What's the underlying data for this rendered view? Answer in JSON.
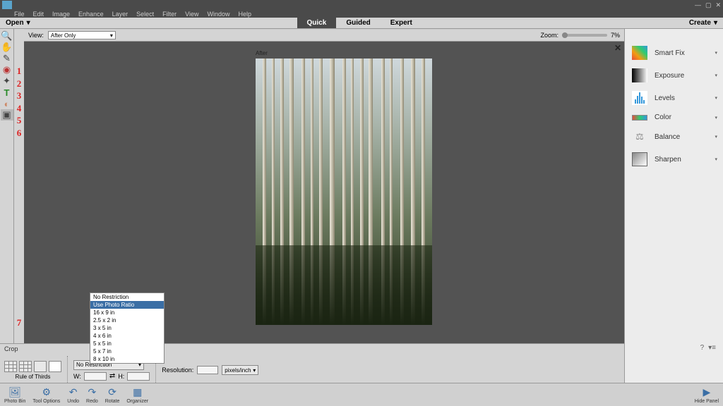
{
  "title_bar": {
    "min": "—",
    "max": "▢",
    "close": "✕"
  },
  "menu": {
    "file": "File",
    "edit": "Edit",
    "image": "Image",
    "enhance": "Enhance",
    "layer": "Layer",
    "select": "Select",
    "filter": "Filter",
    "view": "View",
    "window": "Window",
    "help": "Help"
  },
  "open_bar": {
    "open": "Open",
    "create": "Create"
  },
  "modes": {
    "quick": "Quick",
    "guided": "Guided",
    "expert": "Expert"
  },
  "view_bar": {
    "label": "View:",
    "selected": "After Only",
    "zoom_label": "Zoom:",
    "zoom_value": "7%"
  },
  "workspace": {
    "after": "After",
    "close": "✕"
  },
  "annotations": {
    "n1": "1",
    "n2": "2",
    "n3": "3",
    "n4": "4",
    "n5": "5",
    "n6": "6",
    "n7": "7"
  },
  "right_panel": {
    "smart_fix": "Smart Fix",
    "exposure": "Exposure",
    "levels": "Levels",
    "color": "Color",
    "balance": "Balance",
    "sharpen": "Sharpen"
  },
  "crop": {
    "title": "Crop",
    "rule_of_thirds": "Rule of Thirds",
    "selected_ratio": "No Restriction",
    "w_label": "W:",
    "h_label": "H:",
    "resolution_label": "Resolution:",
    "unit": "pixels/inch",
    "ratios": [
      "No Restriction",
      "Use Photo Ratio",
      "16 x 9 in",
      "2.5 x 2 in",
      "3 x 5 in",
      "4 x 6 in",
      "5 x 5 in",
      "5 x 7 in",
      "8 x 10 in"
    ],
    "ratio_selected_index": 1
  },
  "bottom_bar": {
    "photo_bin": "Photo Bin",
    "tool_options": "Tool Options",
    "undo": "Undo",
    "redo": "Redo",
    "rotate": "Rotate",
    "organizer": "Organizer",
    "hide_panel": "Hide Panel"
  }
}
